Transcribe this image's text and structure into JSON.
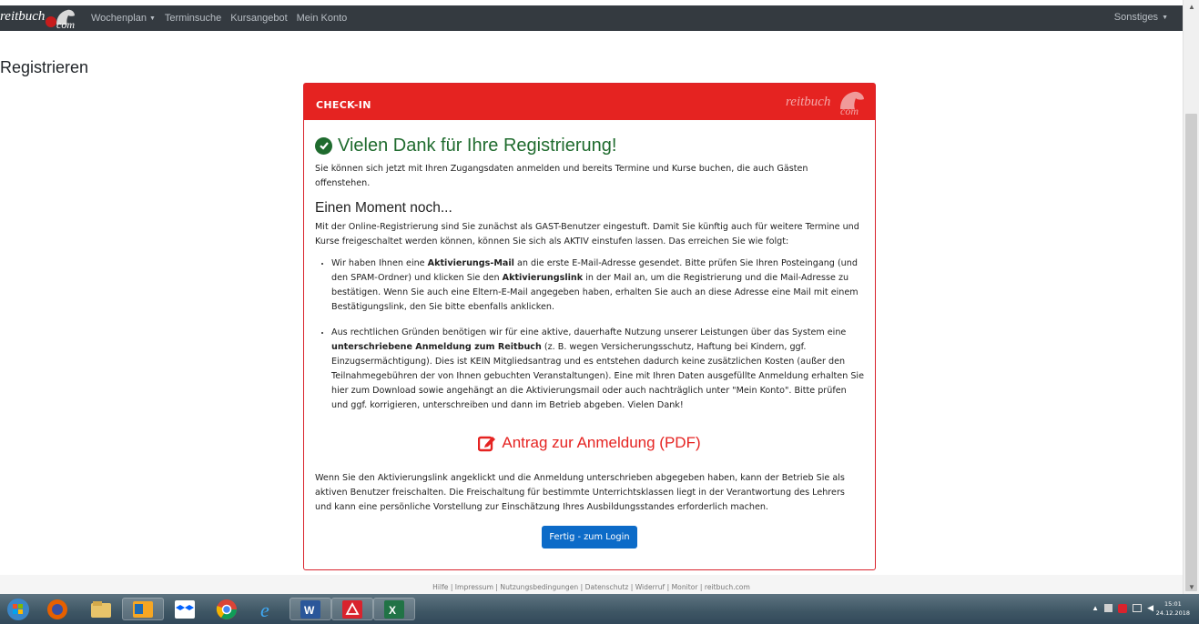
{
  "navbar": {
    "brand_word": "reitbuch",
    "brand_suffix": "com",
    "items": [
      {
        "label": "Wochenplan",
        "dropdown": true
      },
      {
        "label": "Terminsuche",
        "dropdown": false
      },
      {
        "label": "Kursangebot",
        "dropdown": false
      },
      {
        "label": "Mein Konto",
        "dropdown": false
      }
    ],
    "right_label": "Sonstiges"
  },
  "page": {
    "heading": "Registrieren"
  },
  "card": {
    "header_label": "CHECK-IN",
    "logo_word": "reitbuch",
    "logo_suffix": "com",
    "success_title": "Vielen Dank für Ihre Registrierung!",
    "intro": "Sie können sich jetzt mit Ihren Zugangsdaten anmelden und bereits Termine und Kurse buchen, die auch Gästen offenstehen.",
    "moment_heading": "Einen Moment noch...",
    "moment_text": "Mit der Online-Registrierung sind Sie zunächst als GAST-Benutzer eingestuft. Damit Sie künftig auch für weitere Termine und Kurse freigeschaltet werden können, können Sie sich als AKTIV einstufen lassen. Das erreichen Sie wie folgt:",
    "step1": {
      "t1": "Wir haben Ihnen eine ",
      "b1": "Aktivierungs-Mail",
      "t2": " an die erste E-Mail-Adresse gesendet. Bitte prüfen Sie Ihren Posteingang (und den SPAM-Ordner) und klicken Sie den ",
      "b2": "Aktivierungslink",
      "t3": " in der Mail an, um die Registrierung und die Mail-Adresse zu bestätigen. Wenn Sie auch eine Eltern-E-Mail angegeben haben, erhalten Sie auch an diese Adresse eine Mail mit einem Bestätigungslink, den Sie bitte ebenfalls anklicken."
    },
    "step2": {
      "t1": "Aus rechtlichen Gründen benötigen wir für eine aktive, dauerhafte Nutzung unserer Leistungen über das System eine ",
      "b1": "unterschriebene Anmeldung zum Reitbuch",
      "t2": " (z. B. wegen Versicherungsschutz, Haftung bei Kindern, ggf. Einzugsermächtigung). Dies ist KEIN Mitgliedsantrag und es entstehen dadurch keine zusätzlichen Kosten (außer den Teilnahmegebühren der von Ihnen gebuchten Veranstaltungen). Eine mit Ihren Daten ausgefüllte Anmeldung erhalten Sie hier zum Download sowie angehängt an die Aktivierungsmail oder auch nachträglich unter \"Mein Konto\". Bitte prüfen und ggf. korrigieren, unterschreiben und dann im Betrieb abgeben. Vielen Dank!"
    },
    "pdf_link": "Antrag zur Anmeldung (PDF)",
    "closing": "Wenn Sie den Aktivierungslink angeklickt und die Anmeldung unterschrieben abgegeben haben, kann der Betrieb Sie als aktiven Benutzer freischalten. Die Freischaltung für bestimmte Unterrichtsklassen liegt in der Verantwortung des Lehrers und kann eine persönliche Vorstellung zur Einschätzung Ihres Ausbildungsstandes erforderlich machen.",
    "button_label": "Fertig - zum Login"
  },
  "footer": {
    "links": "Hilfe | Impressum | Nutzungsbedingungen | Datenschutz | Widerruf | Monitor | reitbuch.com"
  },
  "taskbar": {
    "time": "15:01",
    "date": "24.12.2018",
    "apps": [
      "start-orb-icon",
      "firefox-icon",
      "file-explorer-icon",
      "outlook-icon",
      "dropbox-icon",
      "chrome-icon",
      "internet-explorer-icon",
      "word-icon",
      "acrobat-icon",
      "excel-icon"
    ]
  },
  "colors": {
    "navbar": "#343a40",
    "card_header": "#e52321",
    "success": "#1f6b2e",
    "pdf_link": "#e52321",
    "button": "#0c6bc8"
  }
}
